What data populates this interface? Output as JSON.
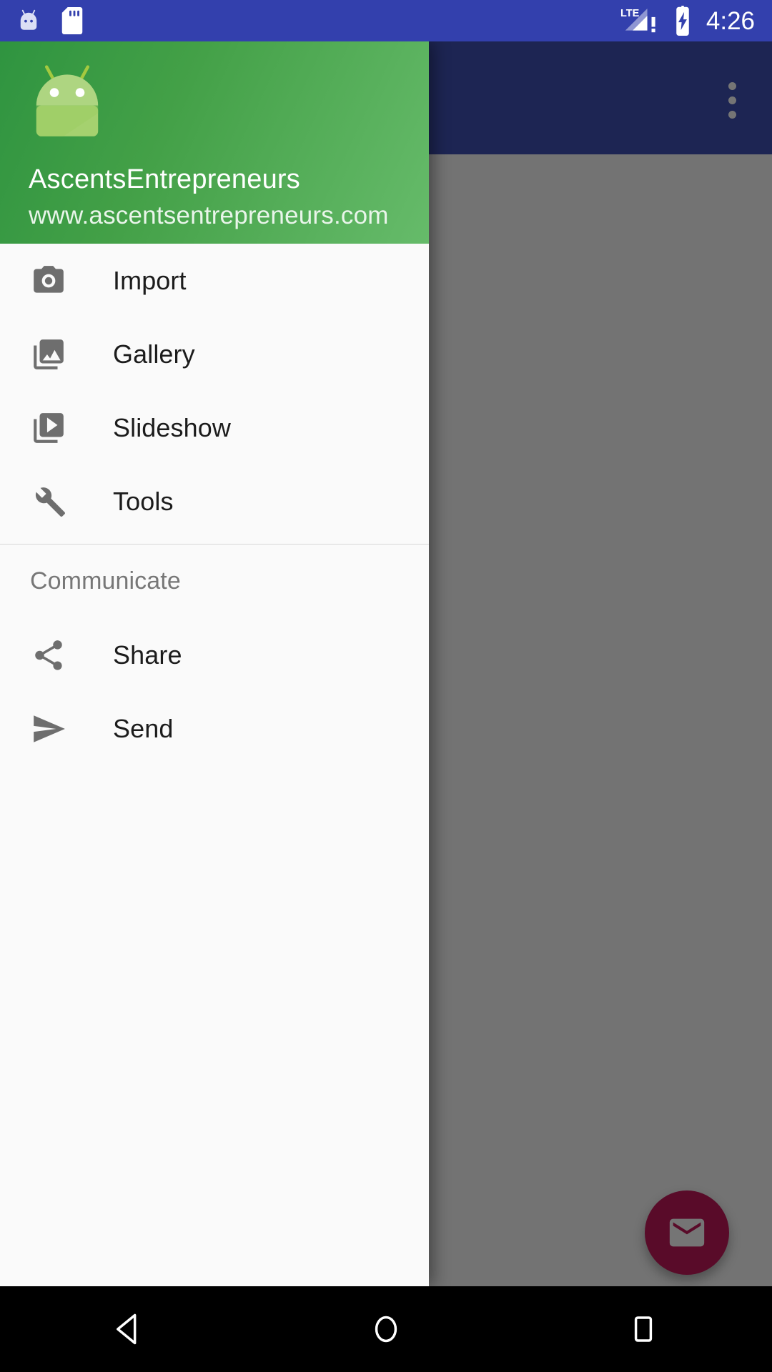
{
  "status_bar": {
    "background": "#3340ad",
    "time": "4:26",
    "icons": [
      {
        "name": "android-bugdroid-icon"
      },
      {
        "name": "sd-card-icon"
      },
      {
        "name": "lte-signal-alert-icon",
        "label": "LTE"
      },
      {
        "name": "battery-charging-icon"
      }
    ]
  },
  "app_bar": {
    "background": "#3f51b5",
    "overflow_menu": "more-options"
  },
  "background_content": {
    "visible_text": "www.ascentsentrepreneurs.com",
    "fab": {
      "name": "email-fab",
      "color": "#c2185b",
      "icon": "email-icon"
    }
  },
  "drawer": {
    "header": {
      "logo": "android-robot-logo",
      "title": "AscentsEntrepreneurs",
      "subtitle": "www.ascentsentrepreneurs.com",
      "gradient_from": "#2f9440",
      "gradient_to": "#66bb6a"
    },
    "primary_items": [
      {
        "label": "Import",
        "icon": "camera-icon"
      },
      {
        "label": "Gallery",
        "icon": "photo-library-icon"
      },
      {
        "label": "Slideshow",
        "icon": "slideshow-icon"
      },
      {
        "label": "Tools",
        "icon": "wrench-icon"
      }
    ],
    "section_header": "Communicate",
    "secondary_items": [
      {
        "label": "Share",
        "icon": "share-icon"
      },
      {
        "label": "Send",
        "icon": "send-icon"
      }
    ]
  },
  "nav_bar": {
    "background": "#000000",
    "buttons": [
      {
        "name": "back-button",
        "icon": "triangle-back-icon"
      },
      {
        "name": "home-button",
        "icon": "circle-home-icon"
      },
      {
        "name": "recents-button",
        "icon": "square-recents-icon"
      }
    ]
  }
}
